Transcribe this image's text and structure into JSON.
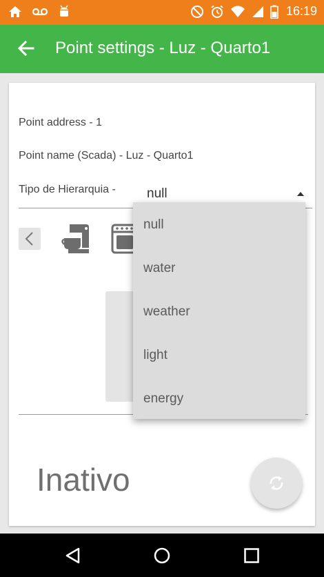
{
  "status_bar": {
    "time": "16:19",
    "icons_left": [
      "home-icon",
      "voicemail-icon",
      "android-icon"
    ],
    "icons_right": [
      "do-not-disturb-icon",
      "alarm-icon",
      "wifi-icon",
      "signal-icon",
      "battery-icon"
    ],
    "bg_color": "#ef7f1a"
  },
  "app_bar": {
    "title": "Point settings - Luz - Quarto1",
    "bg_color": "#43b549"
  },
  "form": {
    "point_address": "Point address - 1",
    "point_name": "Point name (Scada) - Luz - Quarto1",
    "hierarchy_label": "Tipo de Hierarquia -",
    "hierarchy_value": "null"
  },
  "dropdown": {
    "options": [
      "null",
      "water",
      "weather",
      "light",
      "energy"
    ]
  },
  "status": {
    "label": "Inativo"
  }
}
